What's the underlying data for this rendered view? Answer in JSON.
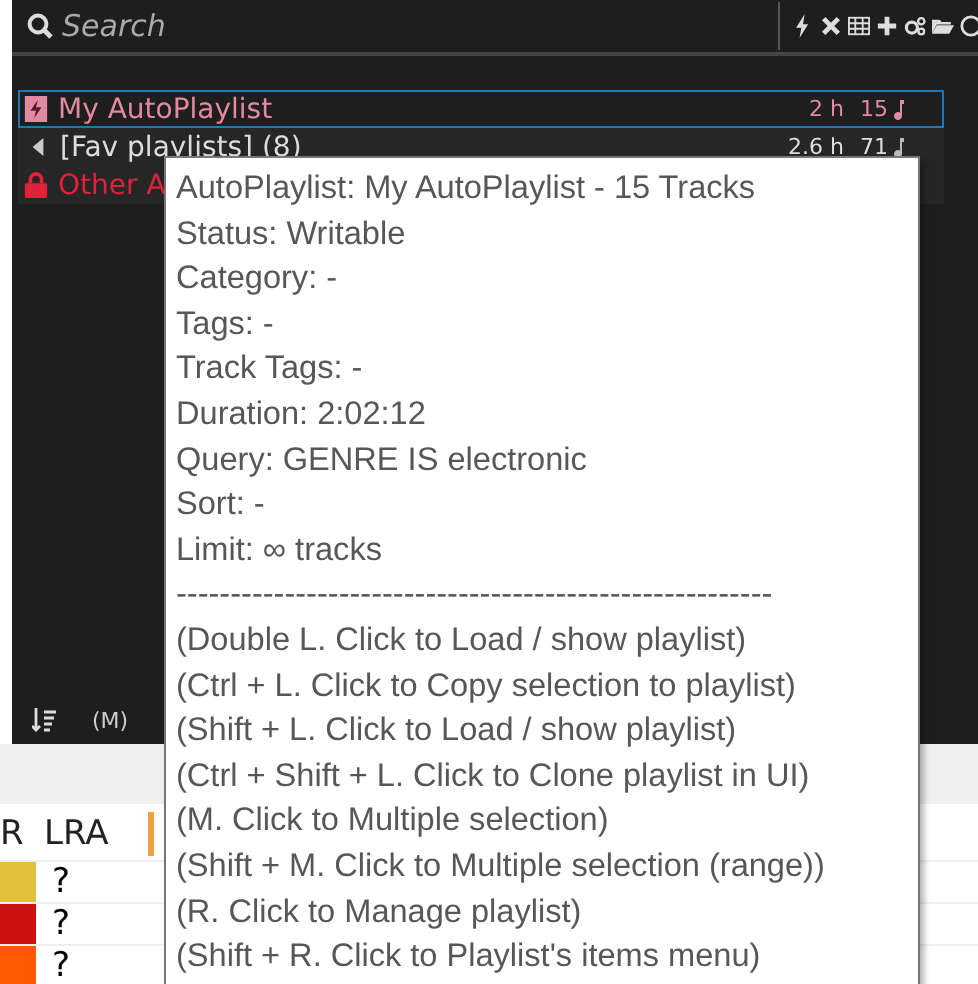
{
  "search": {
    "placeholder": "Search"
  },
  "playlists": [
    {
      "kind": "auto",
      "name": "My AutoPlaylist",
      "duration": "2 h",
      "tracks": "15",
      "selected": true
    },
    {
      "kind": "folder",
      "name": "[Fav playlists] (8)",
      "duration": "2.6 h",
      "tracks": "71",
      "selected": false
    },
    {
      "kind": "locked",
      "name": "Other A",
      "selected": false
    }
  ],
  "bottom_bar": {
    "label": "(M)"
  },
  "table": {
    "columns": [
      "R",
      "LRA"
    ],
    "rows": [
      {
        "color": "#e2bf3c",
        "lra": "?"
      },
      {
        "color": "#cc1111",
        "lra": "?"
      },
      {
        "color": "#ff5a00",
        "lra": "?"
      }
    ]
  },
  "tooltip": {
    "lines": [
      "AutoPlaylist: My AutoPlaylist - 15 Tracks",
      "Status: Writable",
      "Category: -",
      "Tags: -",
      "Track Tags: -",
      "Duration: 2:02:12",
      "Query: GENRE IS electronic",
      "Sort: -",
      "Limit: ∞ tracks",
      "-------------------------------------------------------",
      "(Double L. Click to Load / show playlist)",
      "(Ctrl + L. Click to Copy selection to playlist)",
      "(Shift + L. Click to Load / show playlist)",
      "(Ctrl + Shift + L. Click to Clone playlist in UI)",
      "(M. Click to Multiple selection)",
      "(Shift + M. Click to Multiple selection (range))",
      "(R. Click to Manage playlist)",
      "(Shift + R. Click to Playlist's items menu)"
    ]
  }
}
